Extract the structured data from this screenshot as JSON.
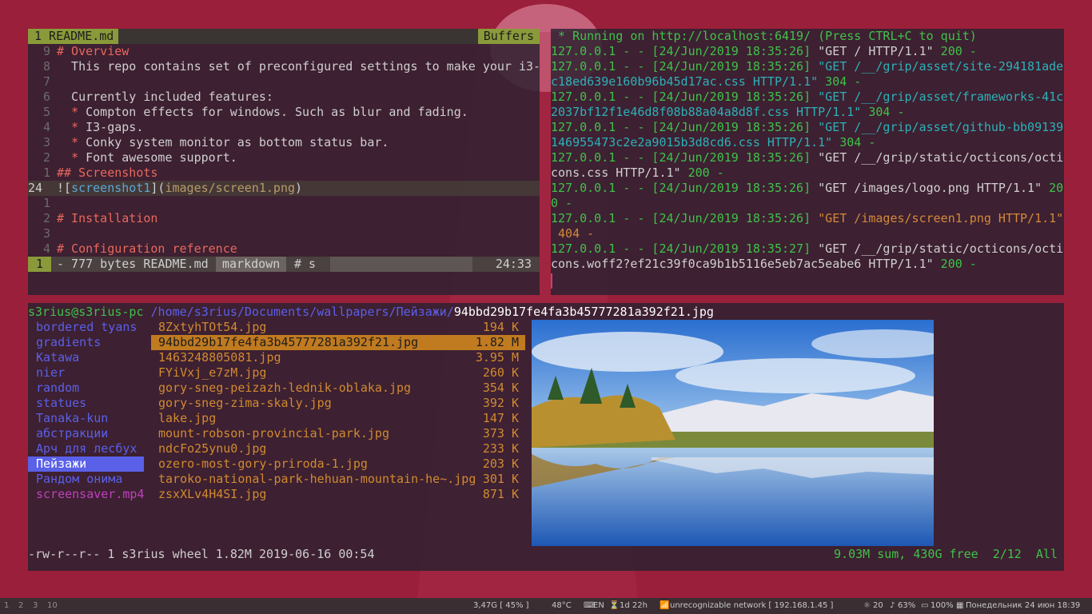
{
  "vim": {
    "tab_label": "1 README.md",
    "buffers_label": "Buffers",
    "lines": [
      {
        "num": "9",
        "text": "# Overview",
        "kind": "hdr"
      },
      {
        "num": "8",
        "text": "  This repo contains set of preconfigured settings to make your i3-",
        "kind": "plain"
      },
      {
        "num": "7",
        "text": "",
        "kind": "plain"
      },
      {
        "num": "6",
        "text": "  Currently included features:",
        "kind": "plain"
      },
      {
        "num": "5",
        "text": "  * Compton effects for windows. Such as blur and fading.",
        "kind": "bullet"
      },
      {
        "num": "4",
        "text": "  * I3-gaps.",
        "kind": "bullet"
      },
      {
        "num": "3",
        "text": "  * Conky system monitor as bottom status bar.",
        "kind": "bullet"
      },
      {
        "num": "2",
        "text": "  * Font awesome support.",
        "kind": "bullet"
      },
      {
        "num": "1",
        "text": "## Screenshots",
        "kind": "hdr"
      },
      {
        "num": "24",
        "text": "![screenshot1](images/screen1.png)",
        "kind": "link",
        "current": true
      },
      {
        "num": "1",
        "text": "",
        "kind": "plain"
      },
      {
        "num": "2",
        "text": "# Installation",
        "kind": "hdr"
      },
      {
        "num": "3",
        "text": "",
        "kind": "plain"
      },
      {
        "num": "4",
        "text": "# Configuration reference",
        "kind": "hdr"
      }
    ],
    "status": {
      "mode": "1",
      "file": "- 777 bytes README.md",
      "filetype": "markdown",
      "extra": "# s",
      "position": "24:33"
    }
  },
  "terminal": {
    "lines": [
      {
        "text": " * Running on http://localhost:6419/ (Press CTRL+C to quit)",
        "color": "green"
      },
      {
        "parts": [
          {
            "t": "127.0.0.1 - - [24/Jun/2019 18:35:26] ",
            "c": "green"
          },
          {
            "t": "\"GET / HTTP/1.1\" ",
            "c": "gray"
          },
          {
            "t": "200 -",
            "c": "green"
          }
        ]
      },
      {
        "parts": [
          {
            "t": "127.0.0.1 - - [24/Jun/2019 18:35:26] ",
            "c": "green"
          },
          {
            "t": "\"GET /__/grip/asset/site-294181ade",
            "c": "cyan"
          }
        ]
      },
      {
        "parts": [
          {
            "t": "c18ed639e160b96b45d17ac.css HTTP/1.1\" ",
            "c": "cyan"
          },
          {
            "t": "304 -",
            "c": "green"
          }
        ]
      },
      {
        "parts": [
          {
            "t": "127.0.0.1 - - [24/Jun/2019 18:35:26] ",
            "c": "green"
          },
          {
            "t": "\"GET /__/grip/asset/frameworks-41c",
            "c": "cyan"
          }
        ]
      },
      {
        "parts": [
          {
            "t": "2037bf12f1e46d8f08b88a04a8d8f.css HTTP/1.1\" ",
            "c": "cyan"
          },
          {
            "t": "304 -",
            "c": "green"
          }
        ]
      },
      {
        "parts": [
          {
            "t": "127.0.0.1 - - [24/Jun/2019 18:35:26] ",
            "c": "green"
          },
          {
            "t": "\"GET /__/grip/asset/github-bb09139",
            "c": "cyan"
          }
        ]
      },
      {
        "parts": [
          {
            "t": "146955473c2e2a9015b3d8cd6.css HTTP/1.1\" ",
            "c": "cyan"
          },
          {
            "t": "304 -",
            "c": "green"
          }
        ]
      },
      {
        "parts": [
          {
            "t": "127.0.0.1 - - [24/Jun/2019 18:35:26] ",
            "c": "green"
          },
          {
            "t": "\"GET /__/grip/static/octicons/octi",
            "c": "gray"
          }
        ]
      },
      {
        "parts": [
          {
            "t": "cons.css HTTP/1.1\" ",
            "c": "gray"
          },
          {
            "t": "200 -",
            "c": "green"
          }
        ]
      },
      {
        "parts": [
          {
            "t": "127.0.0.1 - - [24/Jun/2019 18:35:26] ",
            "c": "green"
          },
          {
            "t": "\"GET /images/logo.png HTTP/1.1\" ",
            "c": "gray"
          },
          {
            "t": "20",
            "c": "green"
          }
        ]
      },
      {
        "parts": [
          {
            "t": "0 -",
            "c": "green"
          }
        ]
      },
      {
        "parts": [
          {
            "t": "127.0.0.1 - - [24/Jun/2019 18:35:26] ",
            "c": "green"
          },
          {
            "t": "\"GET /images/screen1.png HTTP/1.1\"",
            "c": "amber"
          }
        ]
      },
      {
        "parts": [
          {
            "t": " 404 -",
            "c": "amber"
          }
        ]
      },
      {
        "parts": [
          {
            "t": "127.0.0.1 - - [24/Jun/2019 18:35:27] ",
            "c": "green"
          },
          {
            "t": "\"GET /__/grip/static/octicons/octi",
            "c": "gray"
          }
        ]
      },
      {
        "parts": [
          {
            "t": "cons.woff2?ef21c39f0ca9b1b5116e5eb7ac5eabe6 HTTP/1.1\" ",
            "c": "gray"
          },
          {
            "t": "200 -",
            "c": "green"
          }
        ]
      }
    ]
  },
  "ranger": {
    "user_host": "s3rius@s3rius-pc",
    "path": "/home/s3rius/Documents/wallpapers/Пейзажи/",
    "filename": "94bbd29b17fe4fa3b45777281a392f21.jpg",
    "dirs": [
      {
        "name": "bordered tyans"
      },
      {
        "name": "gradients"
      },
      {
        "name": "Katawa"
      },
      {
        "name": "nier"
      },
      {
        "name": "random"
      },
      {
        "name": "statues"
      },
      {
        "name": "Tanaka-kun"
      },
      {
        "name": "абстракции"
      },
      {
        "name": "Арч для лесбух"
      },
      {
        "name": "Пейзажи",
        "selected": true
      },
      {
        "name": "Рандом онима"
      },
      {
        "name": "screensaver.mp4",
        "media": true
      }
    ],
    "files": [
      {
        "name": "8ZxtyhTOt54.jpg",
        "size": "194 K"
      },
      {
        "name": "94bbd29b17fe4fa3b45777281a392f21.jpg",
        "size": "1.82 M",
        "selected": true
      },
      {
        "name": "1463248805081.jpg",
        "size": "3.95 M"
      },
      {
        "name": "FYiVxj_e7zM.jpg",
        "size": "260 K"
      },
      {
        "name": "gory-sneg-peizazh-lednik-oblaka.jpg",
        "size": "354 K"
      },
      {
        "name": "gory-sneg-zima-skaly.jpg",
        "size": "392 K"
      },
      {
        "name": "lake.jpg",
        "size": "147 K"
      },
      {
        "name": "mount-robson-provincial-park.jpg",
        "size": "373 K"
      },
      {
        "name": "ndcFo25ynu0.jpg",
        "size": "233 K"
      },
      {
        "name": "ozero-most-gory-priroda-1.jpg",
        "size": "203 K"
      },
      {
        "name": "taroko-national-park-hehuan-mountain-he~.jpg",
        "size": "301 K"
      },
      {
        "name": "zsxXLv4H4SI.jpg",
        "size": "871 K"
      }
    ],
    "footer_left": "-rw-r--r-- 1 s3rius wheel 1.82M 2019-06-16 00:54",
    "footer_right": "9.03M sum, 430G free  2/12  All"
  },
  "bar": {
    "workspaces": [
      "1",
      "2",
      "3",
      "10"
    ],
    "disk": "3,47G [ 45% ]",
    "temp": "48°C",
    "kbd": "EN",
    "uptime": "1d 22h",
    "net": "unrecognizable network [ 192.168.1.45 ]",
    "brightness": "20",
    "volume": "63%",
    "battery": "100%",
    "datetime": "Понедельник 24 июн 18:39"
  }
}
